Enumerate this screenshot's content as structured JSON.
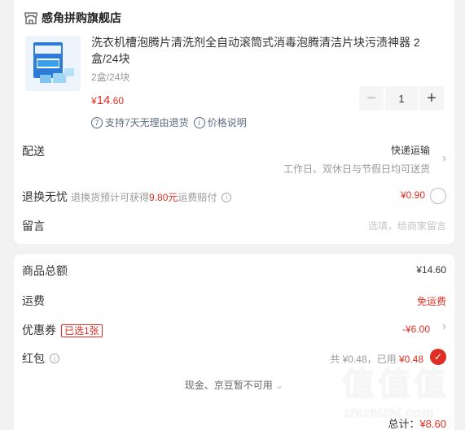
{
  "store": {
    "name": "感角拼购旗舰店",
    "icon": "shop-icon"
  },
  "product": {
    "title": "洗衣机槽泡腾片清洗剂全自动滚筒式消毒泡腾清洁片块污渍神器 2盒/24块",
    "spec": "2盒/24块",
    "price_currency": "¥",
    "price_int": "14",
    "price_dec": ".60",
    "quantity": "1",
    "minus": "−",
    "plus": "+"
  },
  "services": {
    "return_num": "7",
    "return_text": "支持7天无理由退货",
    "price_icon": "i",
    "price_text": "价格说明"
  },
  "delivery": {
    "label": "配送",
    "value": "快递运输",
    "sub": "工作日、双休日与节假日均可送货"
  },
  "return_insurance": {
    "label": "退换无忧",
    "desc_prefix": "退换货预计可获得",
    "desc_amount": "9.80元",
    "desc_suffix": "运费赔付",
    "price": "¥0.90"
  },
  "note": {
    "label": "留言",
    "placeholder": "选填，给商家留言"
  },
  "summary": {
    "goods_label": "商品总额",
    "goods_value": "¥14.60",
    "shipping_label": "运费",
    "shipping_value": "免运费",
    "coupon_label": "优惠券",
    "coupon_badge": "已选1张",
    "coupon_value": "-¥6.00",
    "hongbao_label": "红包",
    "hongbao_total": "共 ¥0.48，已用",
    "hongbao_used": "¥0.48",
    "cash_text": "现金、京豆暂不可用",
    "total_label": "总计：",
    "total_value": "¥8.60"
  },
  "colors": {
    "accent": "#e02e24",
    "service": "#5a6b7f",
    "background": "#f2f2f2"
  },
  "watermark": {
    "glyphs": "值值值",
    "url": "zhizhizhi.com"
  }
}
